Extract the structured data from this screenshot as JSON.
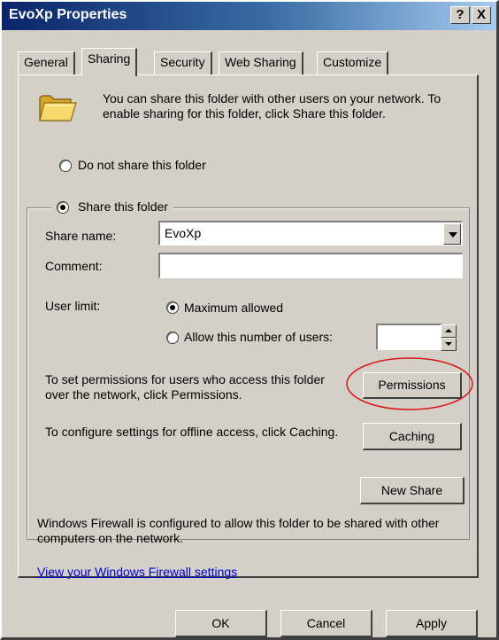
{
  "window": {
    "title": "EvoXp Properties",
    "help_label": "?",
    "close_label": "X"
  },
  "tabs": [
    {
      "label": "General"
    },
    {
      "label": "Sharing"
    },
    {
      "label": "Security"
    },
    {
      "label": "Web Sharing"
    },
    {
      "label": "Customize"
    }
  ],
  "intro_text": "You can share this folder with other users on your network.  To enable sharing for this folder, click Share this folder.",
  "radio_no_share": "Do not share this folder",
  "radio_share": "Share this folder",
  "share_name": {
    "label": "Share name:",
    "value": "EvoXp"
  },
  "comment": {
    "label": "Comment:",
    "value": ""
  },
  "user_limit": {
    "label": "User limit:",
    "option_max": "Maximum allowed",
    "option_number": "Allow this number of users:",
    "number_value": ""
  },
  "permissions": {
    "text": "To set permissions for users who access this folder over the network, click Permissions.",
    "button": "Permissions"
  },
  "caching": {
    "text": "To configure settings for offline access, click Caching.",
    "button": "Caching"
  },
  "new_share_button": "New Share",
  "firewall_text": "Windows Firewall is configured to allow this folder to be shared with other computers on the network.",
  "firewall_link": "View your Windows Firewall settings",
  "footer": {
    "ok": "OK",
    "cancel": "Cancel",
    "apply": "Apply"
  },
  "colors": {
    "face": "#d4d0c8",
    "titlebar": "#0a246a",
    "link": "#0000cc",
    "highlight_circle": "#d81818"
  }
}
